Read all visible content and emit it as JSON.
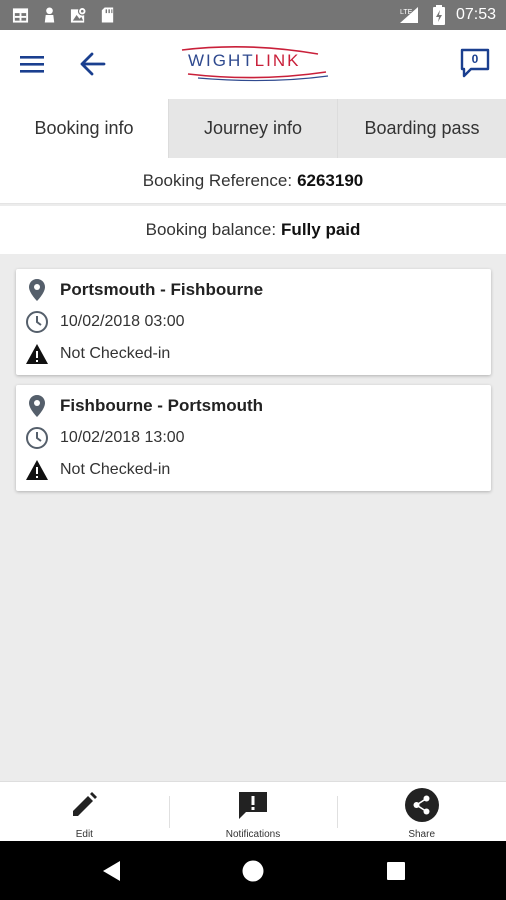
{
  "status_bar": {
    "time": "07:53",
    "network": "LTE"
  },
  "app_bar": {
    "logo_part1": "WIGHT",
    "logo_part2": "LINK",
    "notification_count": "0"
  },
  "tabs": [
    {
      "label": "Booking info",
      "active": true
    },
    {
      "label": "Journey info",
      "active": false
    },
    {
      "label": "Boarding pass",
      "active": false
    }
  ],
  "booking": {
    "reference_label": "Booking Reference:",
    "reference_value": "6263190",
    "balance_label": "Booking balance:",
    "balance_value": "Fully paid"
  },
  "journeys": [
    {
      "route": "Portsmouth - Fishbourne",
      "datetime": "10/02/2018 03:00",
      "status": "Not Checked-in"
    },
    {
      "route": "Fishbourne - Portsmouth",
      "datetime": "10/02/2018 13:00",
      "status": "Not Checked-in"
    }
  ],
  "bottom_bar": {
    "edit": "Edit",
    "notifications": "Notifications",
    "share": "Share"
  },
  "colors": {
    "primary_blue": "#1a3f8f",
    "brand_red": "#c9203a",
    "icon_grey": "#555f6b",
    "background": "#ececec"
  }
}
